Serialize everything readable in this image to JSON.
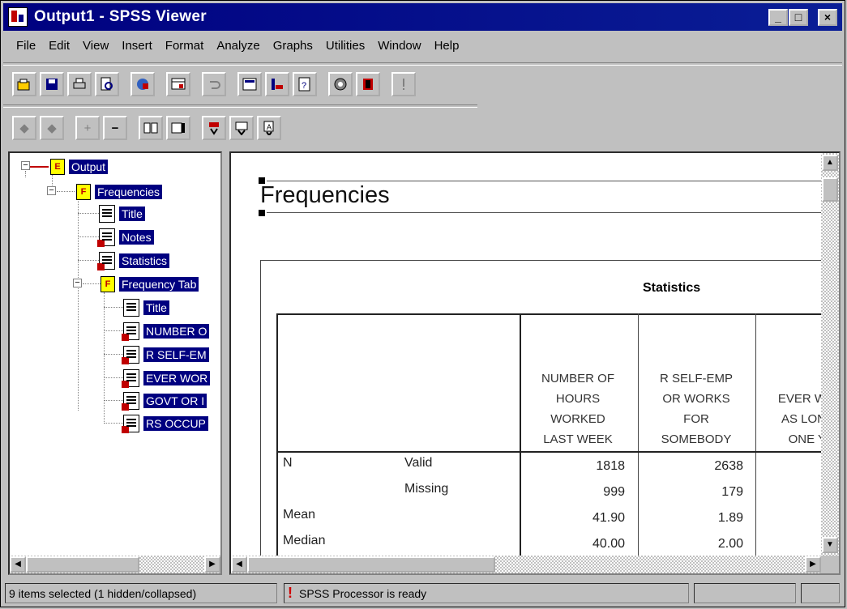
{
  "window": {
    "title": "Output1 - SPSS Viewer",
    "min": "_",
    "max": "□",
    "close": "×"
  },
  "menu": [
    "File",
    "Edit",
    "View",
    "Insert",
    "Format",
    "Analyze",
    "Graphs",
    "Utilities",
    "Window",
    "Help"
  ],
  "toolbar1_icons": [
    "open-icon",
    "save-icon",
    "print-icon",
    "print-preview-icon",
    "export-icon",
    "goto-data-icon",
    "undo-icon",
    "goto-chart-icon",
    "insert-variable-icon",
    "variables-icon",
    "use-sets-icon",
    "select-last-output-icon",
    "designate-window-icon"
  ],
  "toolbar2_icons": [
    "promote-icon",
    "demote-icon",
    "expand-icon",
    "collapse-icon",
    "show-icon",
    "hide-icon",
    "insert-heading-icon",
    "insert-title-icon",
    "insert-text-icon"
  ],
  "tree": {
    "output": "Output",
    "frequencies": "Frequencies",
    "title1": "Title",
    "notes": "Notes",
    "statistics": "Statistics",
    "freq_table": "Frequency Tab",
    "title2": "Title",
    "item1": "NUMBER O",
    "item2": "R SELF-EM",
    "item3": "EVER WOR",
    "item4": "GOVT OR I",
    "item5": "RS OCCUP"
  },
  "content": {
    "heading": "Frequencies",
    "table_title": "Statistics",
    "col1": [
      "NUMBER OF",
      "HOURS",
      "WORKED",
      "LAST WEEK"
    ],
    "col2": [
      "R SELF-EMP",
      "OR WORKS",
      "FOR",
      "SOMEBODY"
    ],
    "col3": [
      "EVER W",
      "AS LON",
      "ONE Y"
    ],
    "rows": [
      {
        "label": "N",
        "sub": "Valid",
        "v1": "1818",
        "v2": "2638"
      },
      {
        "label": "",
        "sub": "Missing",
        "v1": "999",
        "v2": "179"
      },
      {
        "label": "Mean",
        "sub": "",
        "v1": "41.90",
        "v2": "1.89"
      },
      {
        "label": "Median",
        "sub": "",
        "v1": "40.00",
        "v2": "2.00"
      }
    ]
  },
  "status": {
    "selection": "9 items selected (1 hidden/collapsed)",
    "processor": "SPSS Processor  is ready"
  }
}
